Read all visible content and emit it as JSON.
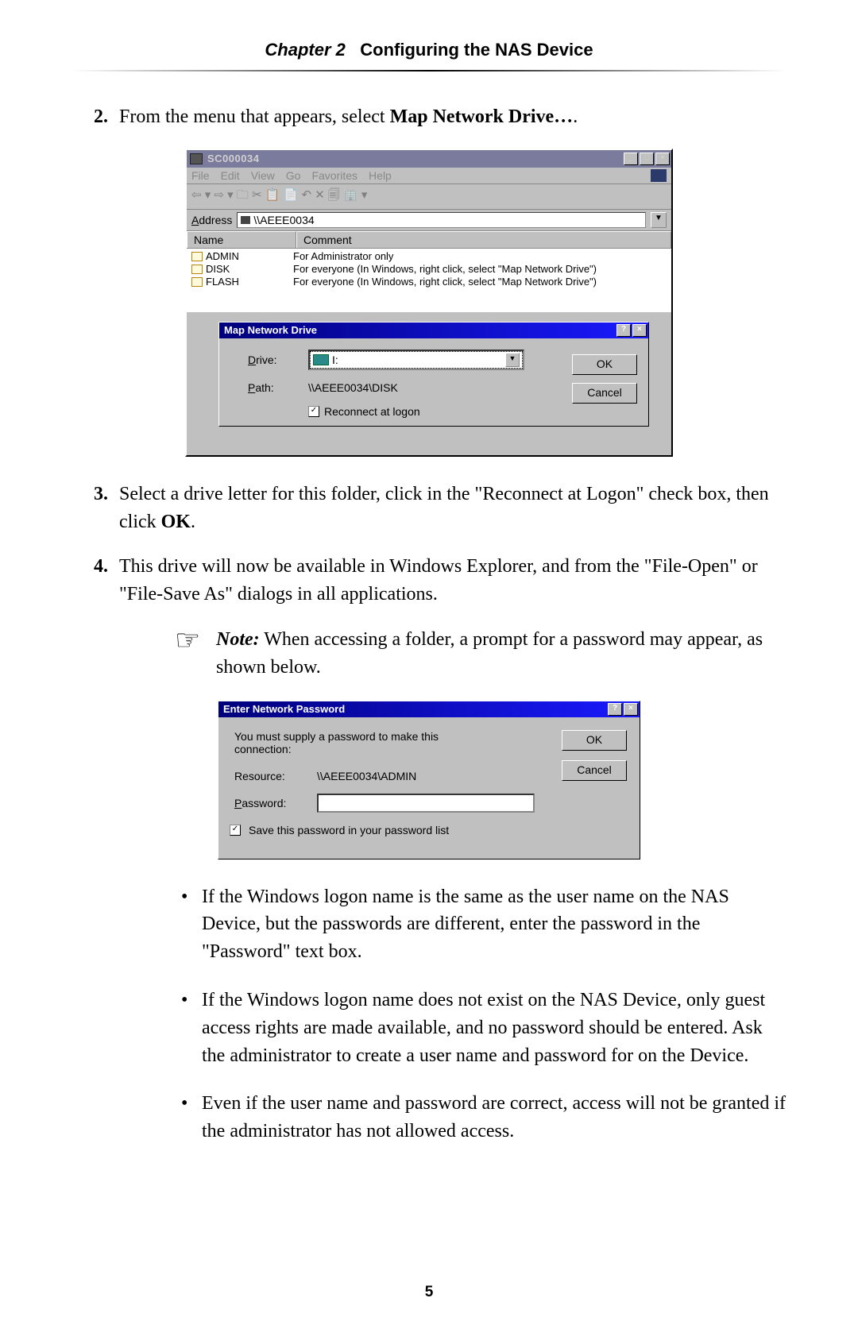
{
  "header": {
    "chapter": "Chapter 2",
    "title": "Configuring the NAS Device"
  },
  "steps": {
    "s2": {
      "num": "2.",
      "pre": "From the menu that appears, select ",
      "bold": "Map Network Drive…",
      "post": "."
    },
    "s3": {
      "num": "3.",
      "pre": "Select a drive letter for this folder, click in the \"Reconnect at Logon\" check box, then click ",
      "bold": "OK",
      "post": "."
    },
    "s4": {
      "num": "4.",
      "text": "This drive will now be available in Windows Explorer, and from the \"File-Open\" or \"File-Save As\" dialogs in all applications."
    }
  },
  "explorer": {
    "title": "SC000034",
    "menus": [
      "File",
      "Edit",
      "View",
      "Go",
      "Favorites",
      "Help"
    ],
    "toolbar_glyphs": "⇦ ▾ ⇨ ▾ 🗀  ✂  📋 📄  ↶  ✕ 🗐  🏢 ▾",
    "address_label": "Address",
    "address": "\\\\AEEE0034",
    "columns": [
      "Name",
      "Comment"
    ],
    "rows": [
      {
        "name": "ADMIN",
        "comment": "For Administrator only"
      },
      {
        "name": "DISK",
        "comment": "For everyone (In Windows, right click, select \"Map Network Drive\")"
      },
      {
        "name": "FLASH",
        "comment": "For everyone (In Windows, right click, select \"Map Network Drive\")"
      }
    ]
  },
  "mapdlg": {
    "title": "Map Network Drive",
    "drive_label": "Drive:",
    "drive_value": "I:",
    "path_label": "Path:",
    "path_value": "\\\\AEEE0034\\DISK",
    "reconnect": "Reconnect at logon",
    "ok": "OK",
    "cancel": "Cancel"
  },
  "note": {
    "label": "Note:",
    "text": " When accessing a folder, a prompt for a password may appear, as shown below."
  },
  "pwdlg": {
    "title": "Enter Network Password",
    "message": "You must supply a password to make this connection:",
    "resource_label": "Resource:",
    "resource": "\\\\AEEE0034\\ADMIN",
    "password_label": "Password:",
    "save": "Save this password in your password list",
    "ok": "OK",
    "cancel": "Cancel"
  },
  "bullets": {
    "b1": "If the Windows logon name is the same as the user name on the NAS Device, but the passwords are different, enter the password in the \"Password\" text box.",
    "b2": "If the Windows logon name does not exist on the NAS Device, only guest access rights are made available, and no password should be entered. Ask the administrator to create a user name and password for on the Device.",
    "b3": "Even if the user name and password are correct, access  will not be granted if the administrator has not allowed access."
  },
  "pagenum": "5"
}
